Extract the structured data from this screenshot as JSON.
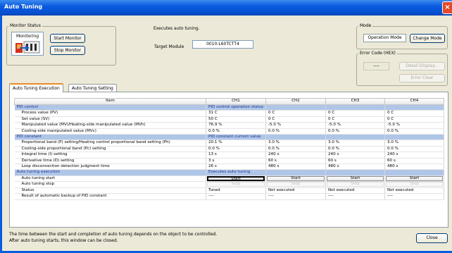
{
  "window": {
    "title": "Auto Tuning",
    "close_icon": "close-icon"
  },
  "monitor_status": {
    "label": "Monitor Status",
    "state": "Monitoring",
    "start_button": "Start Monitor",
    "stop_button": "Stop Monitor"
  },
  "info": {
    "executes_text": "Executes auto tuning.",
    "target_module_label": "Target Module",
    "target_module_value": "0010:L60TCTT4"
  },
  "mode": {
    "label": "Mode",
    "current": "Operation Mode",
    "change_button": "Change Mode"
  },
  "error_code": {
    "label": "Error Code (HEX)",
    "value": "----",
    "detail_button": "Detail Display...",
    "clear_button": "Error Clear"
  },
  "tabs": [
    {
      "label": "Auto Tuning Execution",
      "active": true
    },
    {
      "label": "Auto Tuning Setting",
      "active": false
    }
  ],
  "table": {
    "headers": [
      "Item",
      "CH1",
      "CH2",
      "CH3",
      "CH4"
    ],
    "rows": [
      {
        "type": "section",
        "item": "PID control",
        "ch1": "PID control operation status",
        "ch2": "",
        "ch3": "",
        "ch4": ""
      },
      {
        "type": "row",
        "item": "Process value (PV)",
        "ch1": "31 C",
        "ch2": "0 C",
        "ch3": "0 C",
        "ch4": "0 C"
      },
      {
        "type": "row",
        "item": "Set value (SV)",
        "ch1": "50 C",
        "ch2": "0 C",
        "ch3": "0 C",
        "ch4": "0 C"
      },
      {
        "type": "row",
        "item": "Manipulated value (MV)/Heating-side manipulated value (MVh)",
        "ch1": "76.9 %",
        "ch2": "-5.0 %",
        "ch3": "-5.0 %",
        "ch4": "-5.0 %"
      },
      {
        "type": "row",
        "item": "Cooling-side manipulated value (MVc)",
        "ch1": "0.0 %",
        "ch2": "0.0 %",
        "ch3": "0.0 %",
        "ch4": "0.0 %"
      },
      {
        "type": "section",
        "item": "PID constant",
        "ch1": "PID constant current value",
        "ch2": "",
        "ch3": "",
        "ch4": ""
      },
      {
        "type": "row",
        "item": "Proportional band (P) setting/Heating control proportional band setting (Ph)",
        "ch1": "20.1 %",
        "ch2": "3.0 %",
        "ch3": "3.0 %",
        "ch4": "3.0 %"
      },
      {
        "type": "row",
        "item": "Cooling-side proportional band (Pc) setting",
        "ch1": "0.0 %",
        "ch2": "0.0 %",
        "ch3": "0.0 %",
        "ch4": "0.0 %"
      },
      {
        "type": "row",
        "item": "Integral time (I) setting",
        "ch1": "13 s",
        "ch2": "240 s",
        "ch3": "240 s",
        "ch4": "240 s"
      },
      {
        "type": "row",
        "item": "Derivative time (D) setting",
        "ch1": "3 s",
        "ch2": "60 s",
        "ch3": "60 s",
        "ch4": "60 s"
      },
      {
        "type": "row",
        "item": "Loop disconnection detection judgment time",
        "ch1": "26 s",
        "ch2": "480 s",
        "ch3": "480 s",
        "ch4": "480 s"
      },
      {
        "type": "section",
        "item": "Auto tuning execution",
        "ch1": "Executes auto tuning.",
        "ch2": "",
        "ch3": "",
        "ch4": ""
      },
      {
        "type": "button",
        "item": "Auto tuning start",
        "ch1": "Start",
        "ch2": "Start",
        "ch3": "Start",
        "ch4": "Start"
      },
      {
        "type": "button-disabled",
        "item": "Auto tuning stop",
        "ch1": "Stop",
        "ch2": "Stop",
        "ch3": "Stop",
        "ch4": "Stop"
      },
      {
        "type": "row",
        "item": "Status",
        "ch1": "Tuned",
        "ch2": "Not executed",
        "ch3": "Not executed",
        "ch4": "Not executed"
      },
      {
        "type": "row",
        "item": "Result of automatic backup of PID constant",
        "ch1": "----",
        "ch2": "----",
        "ch3": "----",
        "ch4": "----"
      }
    ]
  },
  "footer": {
    "line1": "The time between the start and completion of auto tuning depends on the object to be controlled.",
    "line2": "After auto tuning starts, this window can be closed.",
    "close_button": "Close"
  }
}
